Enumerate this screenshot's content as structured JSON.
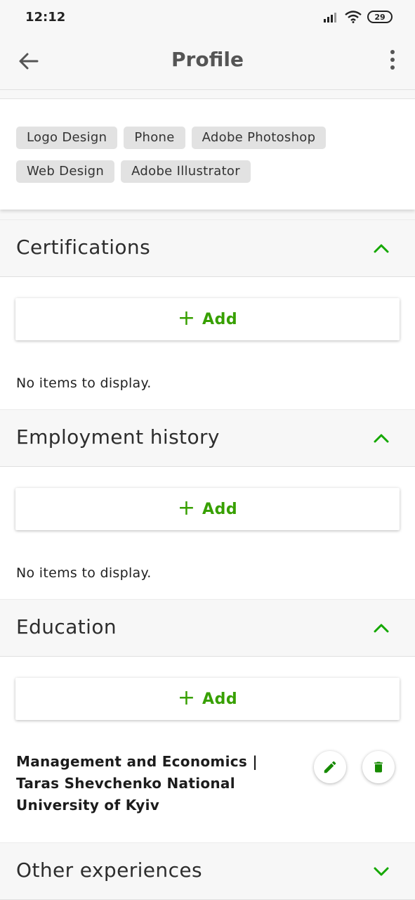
{
  "status_bar": {
    "time": "12:12",
    "battery": "29",
    "icons": [
      "signal-icon",
      "wifi-icon",
      "battery-icon"
    ]
  },
  "app_bar": {
    "title": "Profile",
    "back_icon": "arrow-back-icon",
    "menu_icon": "more-vert-icon"
  },
  "skills": [
    "Logo Design",
    "Phone",
    "Adobe Photoshop",
    "Web Design",
    "Adobe Illustrator"
  ],
  "sections": {
    "certifications": {
      "title": "Certifications",
      "add_label": "Add",
      "empty_text": "No items to display.",
      "expanded": true
    },
    "employment": {
      "title": "Employment history",
      "add_label": "Add",
      "empty_text": "No items to display.",
      "expanded": true
    },
    "education": {
      "title": "Education",
      "add_label": "Add",
      "expanded": true,
      "items": [
        {
          "title": "Management and Economics | Taras Shevchenko National University of Kyiv"
        }
      ]
    },
    "other": {
      "title": "Other experiences",
      "expanded": false
    }
  },
  "colors": {
    "accent": "#37a000",
    "chevron": "#14a800",
    "background": "#f7f7f7"
  }
}
